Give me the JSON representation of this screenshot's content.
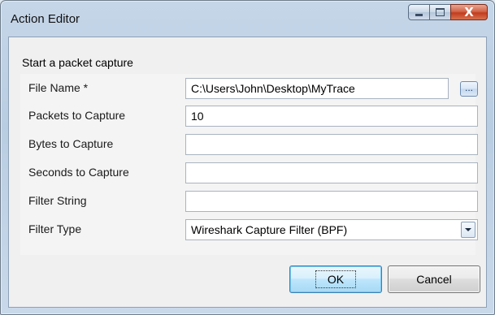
{
  "window": {
    "title": "Action Editor",
    "minimize_icon": "minimize-icon",
    "maximize_icon": "maximize-icon",
    "close_glyph": "X"
  },
  "section": {
    "title": "Start a packet capture"
  },
  "fields": {
    "file_name": {
      "label": "File Name *",
      "value": "C:\\Users\\John\\Desktop\\MyTrace"
    },
    "packets": {
      "label": "Packets to Capture",
      "value": "10"
    },
    "bytes": {
      "label": "Bytes to Capture",
      "value": ""
    },
    "seconds": {
      "label": "Seconds to Capture",
      "value": ""
    },
    "filter_string": {
      "label": "Filter String",
      "value": ""
    },
    "filter_type": {
      "label": "Filter Type",
      "value": "Wireshark Capture Filter (BPF)"
    }
  },
  "browse_label": "...",
  "buttons": {
    "ok": "OK",
    "cancel": "Cancel"
  },
  "colors": {
    "accent": "#3c7fb1",
    "close": "#c23c1e"
  }
}
